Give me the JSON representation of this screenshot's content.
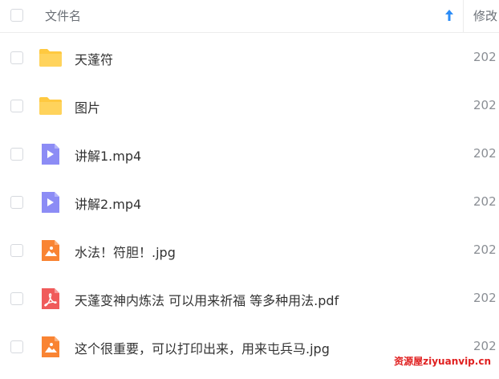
{
  "header": {
    "name_column_label": "文件名",
    "modified_column_label": "修改",
    "sort_icon": "arrow-up-icon",
    "accent_color": "#2b8cf7"
  },
  "files": [
    {
      "name": "天蓬符",
      "modified": "202",
      "icon": "folder-icon"
    },
    {
      "name": "图片",
      "modified": "202",
      "icon": "folder-icon"
    },
    {
      "name": "讲解1.mp4",
      "modified": "202",
      "icon": "video-file-icon"
    },
    {
      "name": "讲解2.mp4",
      "modified": "202",
      "icon": "video-file-icon"
    },
    {
      "name": "水法！符胆！.jpg",
      "modified": "202",
      "icon": "image-file-icon"
    },
    {
      "name": "天蓬变神内炼法 可以用来祈福 等多种用法.pdf",
      "modified": "202",
      "icon": "pdf-file-icon"
    },
    {
      "name": "这个很重要，可以打印出来，用来屯兵马.jpg",
      "modified": "202",
      "icon": "image-file-icon"
    }
  ],
  "watermark": "资源屋ziyuanvip.cn",
  "colors": {
    "folder": "#ffc940",
    "video": "#8c8cf5",
    "image": "#f98433",
    "pdf": "#f05b5b"
  }
}
